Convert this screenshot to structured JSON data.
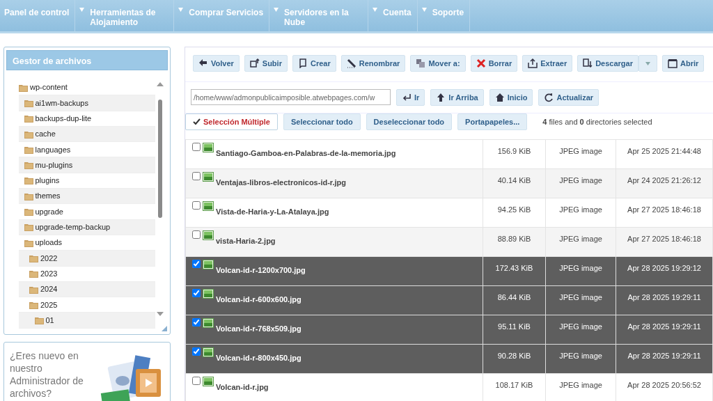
{
  "nav": [
    {
      "label": "Panel de control",
      "dropdown": false
    },
    {
      "label": "Herramientas de Alojamiento",
      "dropdown": true
    },
    {
      "label": "Comprar Servicios",
      "dropdown": true
    },
    {
      "label": "Servidores en la Nube",
      "dropdown": true
    },
    {
      "label": "Cuenta",
      "dropdown": true
    },
    {
      "label": "Soporte",
      "dropdown": true
    }
  ],
  "sidebar": {
    "title": "Gestor de archivos",
    "tree": [
      {
        "label": "wp-content",
        "children": [
          {
            "label": "ai1wm-backups"
          },
          {
            "label": "backups-dup-lite"
          },
          {
            "label": "cache"
          },
          {
            "label": "languages"
          },
          {
            "label": "mu-plugins"
          },
          {
            "label": "plugins"
          },
          {
            "label": "themes"
          },
          {
            "label": "upgrade"
          },
          {
            "label": "upgrade-temp-backup"
          },
          {
            "label": "uploads",
            "children": [
              {
                "label": "2022"
              },
              {
                "label": "2023"
              },
              {
                "label": "2024"
              },
              {
                "label": "2025",
                "children": [
                  {
                    "label": "01"
                  }
                ]
              }
            ]
          }
        ]
      }
    ],
    "promo": {
      "text": "¿Eres nuevo en nuestro Administrador de archivos?"
    }
  },
  "toolbar": [
    {
      "label": "Volver",
      "split": false
    },
    {
      "label": "Subir",
      "split": false
    },
    {
      "label": "Crear",
      "split": false
    },
    {
      "label": "Renombrar",
      "split": false
    },
    {
      "label": "Mover a:",
      "split": false
    },
    {
      "label": "Borrar",
      "split": false
    },
    {
      "label": "Extraer",
      "split": false
    },
    {
      "label": "Descargar",
      "split": true
    },
    {
      "label": "Abrir",
      "split": false
    }
  ],
  "path": {
    "value": "/home/www/admonpublicaimposible.atwebpages.com/w"
  },
  "nav_buttons": [
    {
      "label": "Ir"
    },
    {
      "label": "Ir Arriba"
    },
    {
      "label": "Inicio"
    },
    {
      "label": "Actualizar"
    }
  ],
  "selection_buttons": [
    {
      "label": "Selección Múltiple",
      "selected": true
    },
    {
      "label": "Seleccionar todo",
      "selected": false
    },
    {
      "label": "Deseleccionar todo",
      "selected": false
    },
    {
      "label": "Portapapeles...",
      "selected": false
    }
  ],
  "selection_status": "**4** files and **0** directories selected",
  "files": [
    {
      "name": "Santiago-Gamboa-en-Palabras-de-la-memoria.jpg",
      "size": "156.9 KiB",
      "type": "JPEG image",
      "date": "Apr 25 2025 21:44:48",
      "selected": false
    },
    {
      "name": "Ventajas-libros-electronicos-id-r.jpg",
      "size": "40.14 KiB",
      "type": "JPEG image",
      "date": "Apr 24 2025 21:26:12",
      "selected": false
    },
    {
      "name": "Vista-de-Haria-y-La-Atalaya.jpg",
      "size": "94.25 KiB",
      "type": "JPEG image",
      "date": "Apr 27 2025 18:46:18",
      "selected": false
    },
    {
      "name": "vista-Haria-2.jpg",
      "size": "88.89 KiB",
      "type": "JPEG image",
      "date": "Apr 27 2025 18:46:18",
      "selected": false
    },
    {
      "name": "Volcan-id-r-1200x700.jpg",
      "size": "172.43 KiB",
      "type": "JPEG image",
      "date": "Apr 28 2025 19:29:12",
      "selected": true
    },
    {
      "name": "Volcan-id-r-600x600.jpg",
      "size": "86.44 KiB",
      "type": "JPEG image",
      "date": "Apr 28 2025 19:29:11",
      "selected": true
    },
    {
      "name": "Volcan-id-r-768x509.jpg",
      "size": "95.11 KiB",
      "type": "JPEG image",
      "date": "Apr 28 2025 19:29:11",
      "selected": true
    },
    {
      "name": "Volcan-id-r-800x450.jpg",
      "size": "90.28 KiB",
      "type": "JPEG image",
      "date": "Apr 28 2025 19:29:11",
      "selected": true
    },
    {
      "name": "Volcan-id-r.jpg",
      "size": "108.17 KiB",
      "type": "JPEG image",
      "date": "Apr 28 2025 20:56:52",
      "selected": false
    }
  ]
}
